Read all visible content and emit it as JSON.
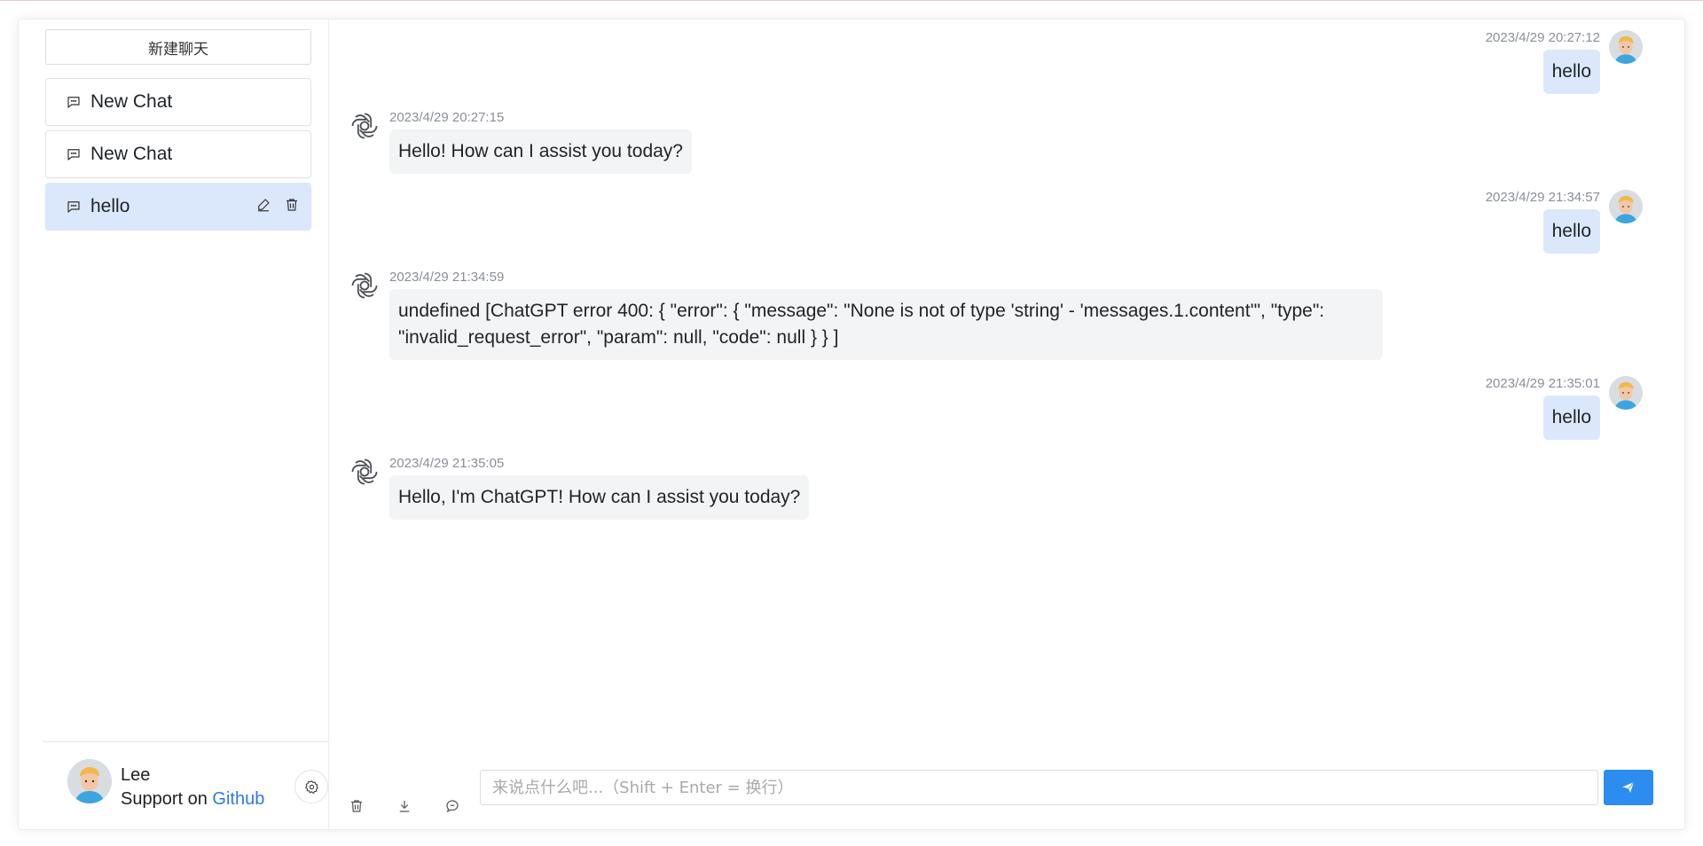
{
  "sidebar": {
    "new_chat_label": "新建聊天",
    "items": [
      {
        "label": "New Chat",
        "icon": "chat-icon"
      },
      {
        "label": "New Chat",
        "icon": "chat-icon"
      },
      {
        "label": "hello",
        "icon": "chat-icon",
        "active": true
      }
    ],
    "user": {
      "name": "Lee",
      "support_text": "Support on",
      "support_link": "Github"
    }
  },
  "messages": [
    {
      "role": "user",
      "time": "2023/4/29 20:27:12",
      "text": "hello"
    },
    {
      "role": "assistant",
      "time": "2023/4/29 20:27:15",
      "text": "Hello! How can I assist you today?"
    },
    {
      "role": "user",
      "time": "2023/4/29 21:34:57",
      "text": "hello"
    },
    {
      "role": "assistant",
      "time": "2023/4/29 21:34:59",
      "text": "undefined [ChatGPT error 400: { \"error\": { \"message\": \"None is not of type 'string' - 'messages.1.content'\", \"type\": \"invalid_request_error\", \"param\": null, \"code\": null } } ]"
    },
    {
      "role": "user",
      "time": "2023/4/29 21:35:01",
      "text": "hello"
    },
    {
      "role": "assistant",
      "time": "2023/4/29 21:35:05",
      "text": "Hello, I'm ChatGPT! How can I assist you today?"
    }
  ],
  "input": {
    "placeholder": "来说点什么吧...（Shift + Enter = 换行）",
    "value": ""
  },
  "colors": {
    "accent": "#2d8cf0",
    "user_bubble": "#dbe8fb",
    "bot_bubble": "#f3f4f5",
    "link": "#2d7ae5"
  }
}
